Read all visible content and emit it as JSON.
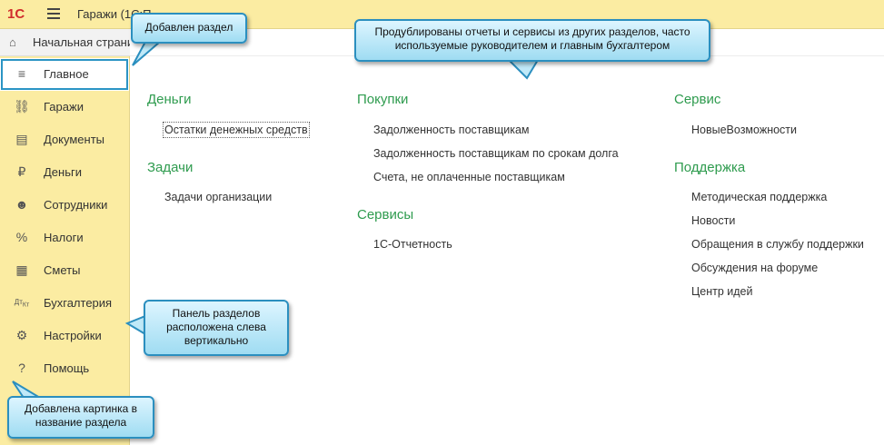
{
  "topbar": {
    "logo": "1С",
    "title": "Гаражи  (1С:П..."
  },
  "home": {
    "label": "Начальная страница"
  },
  "sidebar": {
    "items": [
      {
        "label": "Главное",
        "icon": "list-icon",
        "active": true
      },
      {
        "label": "Гаражи",
        "icon": "car-icon"
      },
      {
        "label": "Документы",
        "icon": "document-icon"
      },
      {
        "label": "Деньги",
        "icon": "ruble-icon"
      },
      {
        "label": "Сотрудники",
        "icon": "person-icon"
      },
      {
        "label": "Налоги",
        "icon": "percent-icon"
      },
      {
        "label": "Сметы",
        "icon": "calculator-icon"
      },
      {
        "label": "Бухгалтерия",
        "icon": "dt-kt-icon"
      },
      {
        "label": "Настройки",
        "icon": "gear-icon"
      },
      {
        "label": "Помощь",
        "icon": "question-icon"
      }
    ]
  },
  "content": {
    "col1": {
      "sections": [
        {
          "title": "Деньги",
          "links": [
            "Остатки денежных средств"
          ]
        },
        {
          "title": "Задачи",
          "links": [
            "Задачи организации"
          ]
        }
      ]
    },
    "col2": {
      "sections": [
        {
          "title": "Покупки",
          "links": [
            "Задолженность поставщикам",
            "Задолженность поставщикам по срокам долга",
            "Счета, не оплаченные поставщикам"
          ]
        },
        {
          "title": "Сервисы",
          "links": [
            "1С-Отчетность"
          ]
        }
      ]
    },
    "col3": {
      "sections": [
        {
          "title": "Сервис",
          "links": [
            "НовыеВозможности"
          ]
        },
        {
          "title": "Поддержка",
          "links": [
            "Методическая поддержка",
            "Новости",
            "Обращения в службу поддержки",
            "Обсуждения на форуме",
            "Центр идей"
          ]
        }
      ]
    }
  },
  "callouts": {
    "section_added": "Добавлен раздел",
    "duplicated": "Продублированы отчеты и сервисы из других разделов, часто используемые руководителем и главным бухгалтером",
    "panel": "Панель разделов расположена слева вертикально",
    "picture": "Добавлена картинка в название раздела"
  },
  "colors": {
    "sidebar_bg": "#fbeca2",
    "section_title": "#2e9b4e",
    "active_border": "#2b94c4",
    "callout_border": "#2b8fbf"
  }
}
